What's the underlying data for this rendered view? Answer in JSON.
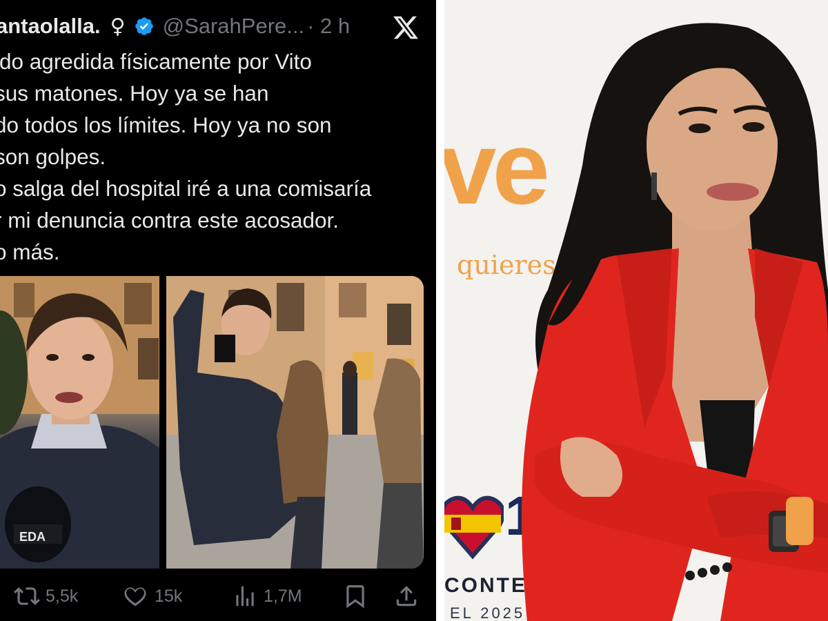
{
  "tweet": {
    "display_name": "antaolalla.",
    "gender_symbol": "♀",
    "handle": "@SarahPere...",
    "timestamp": "· 2 h",
    "lines": [
      "ido agredida físicamente por Vito",
      "sus matones. Hoy ya se han",
      "do todos los límites. Hoy ya no son",
      "son golpes.",
      "o salga del hospital iré a una comisaría",
      "r mi denuncia contra este acosador.",
      "o más."
    ],
    "actions": {
      "reposts": "5,5k",
      "likes": "15k",
      "views": "1,7M"
    }
  },
  "photo": {
    "backdrop_logo": "ve",
    "backdrop_slogan": "quieres",
    "backdrop_contest": "CONTES",
    "backdrop_year": "EL 2025",
    "backdrop_number": "19"
  },
  "colors": {
    "tweet_bg": "#000000",
    "tweet_text": "#e7e9ea",
    "muted": "#71767b",
    "verified_blue": "#1d9bf0",
    "rtve_orange": "#f0a24a",
    "blazer_red": "#e0251f"
  },
  "icons": [
    "verified-badge-icon",
    "x-logo-icon",
    "repost-icon",
    "like-icon",
    "views-icon",
    "bookmark-icon",
    "share-icon"
  ]
}
